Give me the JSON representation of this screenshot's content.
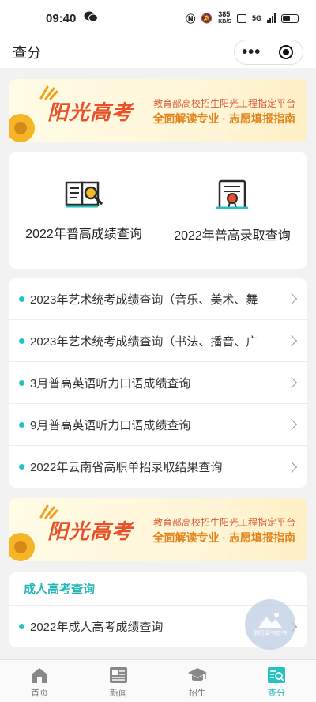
{
  "status_bar": {
    "time": "09:40",
    "speed_value": "385",
    "speed_unit": "KB/S",
    "network": "5G"
  },
  "navbar": {
    "title": "查分"
  },
  "banner": {
    "brand": "阳光高考",
    "line1": "教育部高校招生阳光工程指定平台",
    "line2": "全面解读专业 · 志愿填报指南"
  },
  "quick_links": [
    {
      "label": "2022年普高成绩查询",
      "icon": "book-magnifier-icon"
    },
    {
      "label": "2022年普高录取查询",
      "icon": "certificate-icon"
    }
  ],
  "query_list": [
    "2023年艺术统考成绩查询（音乐、美术、舞",
    "2023年艺术统考成绩查询（书法、播音、广",
    "3月普高英语听力口语成绩查询",
    "9月普高英语听力口语成绩查询",
    "2022年云南省高职单招录取结果查询"
  ],
  "adult_section": {
    "title": "成人高考查询",
    "items": [
      "2022年成人高考成绩查询"
    ]
  },
  "float_button": {
    "caption": "购叮朵书店书"
  },
  "tabbar": [
    {
      "label": "首页",
      "icon": "home-icon",
      "active": false
    },
    {
      "label": "新闻",
      "icon": "news-icon",
      "active": false
    },
    {
      "label": "招生",
      "icon": "graduation-cap-icon",
      "active": false
    },
    {
      "label": "查分",
      "icon": "score-search-icon",
      "active": true
    }
  ],
  "colors": {
    "accent": "#25c2c0",
    "banner_text": "#e7522a",
    "banner_sub": "#e0851c"
  }
}
